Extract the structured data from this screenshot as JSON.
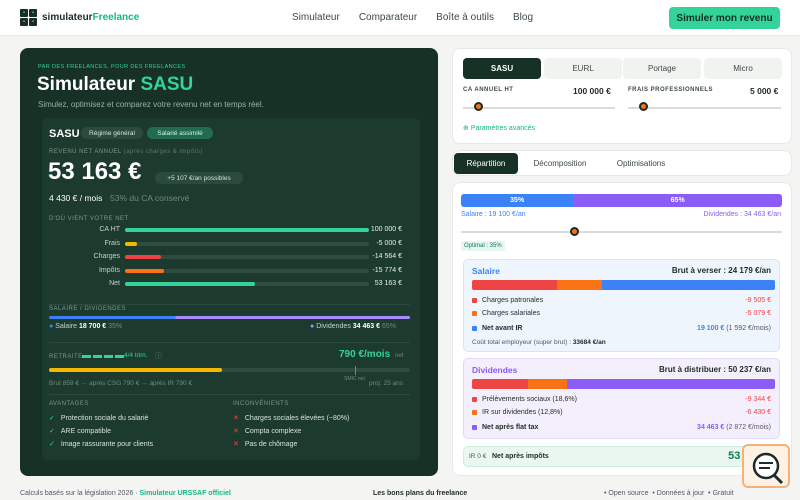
{
  "nav": {
    "brand_main": "simulateur",
    "brand_accent": "Freelance",
    "links": [
      "Simulateur",
      "Comparateur",
      "Boîte à outils",
      "Blog"
    ],
    "cta": "Simuler mon revenu"
  },
  "hero": {
    "kicker": "PAR DES FREELANCES, POUR DES FREELANCES",
    "title_main": "Simulateur ",
    "title_accent": "SASU",
    "subtitle": "Simulez, optimisez et comparez votre revenu net en temps réel."
  },
  "card": {
    "status": "SASU",
    "badge1": "Régime général",
    "badge2": "Salarié assimilé",
    "net_label": "REVENU NET ANNUEL",
    "net_note": "(après charges & impôts)",
    "net_value": "53 163 €",
    "possible": "+5 107 €/an possibles",
    "monthly": "4 430 € / mois",
    "share": "53% du CA conservé",
    "breakdown_title": "D'OÙ VIENT VOTRE NET",
    "breakdown": [
      {
        "name": "CA HT",
        "value": "100 000 €",
        "pct": 100,
        "color": "#34d399"
      },
      {
        "name": "Frais",
        "value": "-5 000 €",
        "pct": 5,
        "color": "#f5b800"
      },
      {
        "name": "Charges",
        "value": "-14 564 €",
        "pct": 14.6,
        "color": "#ef4444"
      },
      {
        "name": "Impôts",
        "value": "-15 774 €",
        "pct": 15.8,
        "color": "#f97316"
      },
      {
        "name": "Net",
        "value": "53 163 €",
        "pct": 53.2,
        "color": "#34d399"
      }
    ],
    "split_title": "SALAIRE / DIVIDENDES",
    "salary_label": "Salaire",
    "salary_value": "18 700 €",
    "salary_pct": "35%",
    "div_label": "Dividendes",
    "div_value": "34 463 €",
    "div_pct": "65%",
    "retire_title": "RETRAITE",
    "retire_trims": "4/4 trim.",
    "retire_value": "790 €/mois",
    "retire_unit": "net",
    "retire_detail": "Brut 859 € → après CSG 790 € → après IR 790 €",
    "retire_proj": "proj. 25 ans",
    "retire_smic": "SMIC net",
    "adv_title": "AVANTAGES",
    "advantages": [
      "Protection sociale du salarié",
      "ARE compatible",
      "Image rassurante pour clients"
    ],
    "inc_title": "INCONVÉNIENTS",
    "inconvenients": [
      "Charges sociales élevées (~80%)",
      "Compta complexe",
      "Pas de chômage"
    ]
  },
  "controls": {
    "status_tabs": [
      "SASU",
      "EURL",
      "Portage",
      "Micro"
    ],
    "ca_label": "CA ANNUEL HT",
    "ca_value": "100 000 €",
    "frais_label": "FRAIS PROFESSIONNELS",
    "frais_value": "5 000 €",
    "params": "Paramètres avancés",
    "ca_level": 0.1,
    "frais_level": 0.1
  },
  "tabs": [
    "Répartition",
    "Décomposition",
    "Optimisations"
  ],
  "repartition": {
    "sal_pct": "35%",
    "div_pct": "65%",
    "sal_text": "Salaire : 19 100 €/an",
    "div_text": "Dividendes : 34 463 €/an",
    "optimal": "Optimal : 35%",
    "salaire_title": "Salaire",
    "salaire_brut": "Brut à verser : 24 179 €/an",
    "charges_pat": "Charges patronales",
    "charges_pat_v": "-9 505 €",
    "charges_sal": "Charges salariales",
    "charges_sal_v": "-5 079 €",
    "net_ir": "Net avant IR",
    "net_ir_v": "19 100 €",
    "net_ir_m": "(1 592 €/mois)",
    "cout": "Coût total employeur (super brut) :",
    "cout_v": "33684 €/an",
    "div_title": "Dividendes",
    "div_brut": "Brut à distribuer : 50 237 €/an",
    "prel": "Prélèvements sociaux (18,6%)",
    "prel_v": "-9 344 €",
    "ir_div": "IR sur dividendes (12,8%)",
    "ir_div_v": "-6 430 €",
    "net_flat": "Net après flat tax",
    "net_flat_v": "34 463 €",
    "net_flat_m": "(2 872 €/mois)",
    "ir_label": "IR 0 €",
    "net_impots": "Net après impôts",
    "net_impots_v": "53 163 €"
  },
  "footer": {
    "left": "Calculs basés sur la législation 2026 · ",
    "link": "Simulateur URSSAF officiel",
    "mid": "Les bons plans du freelance",
    "r1": "Open source",
    "r2": "Données à jour",
    "r3": "Gratuit"
  }
}
